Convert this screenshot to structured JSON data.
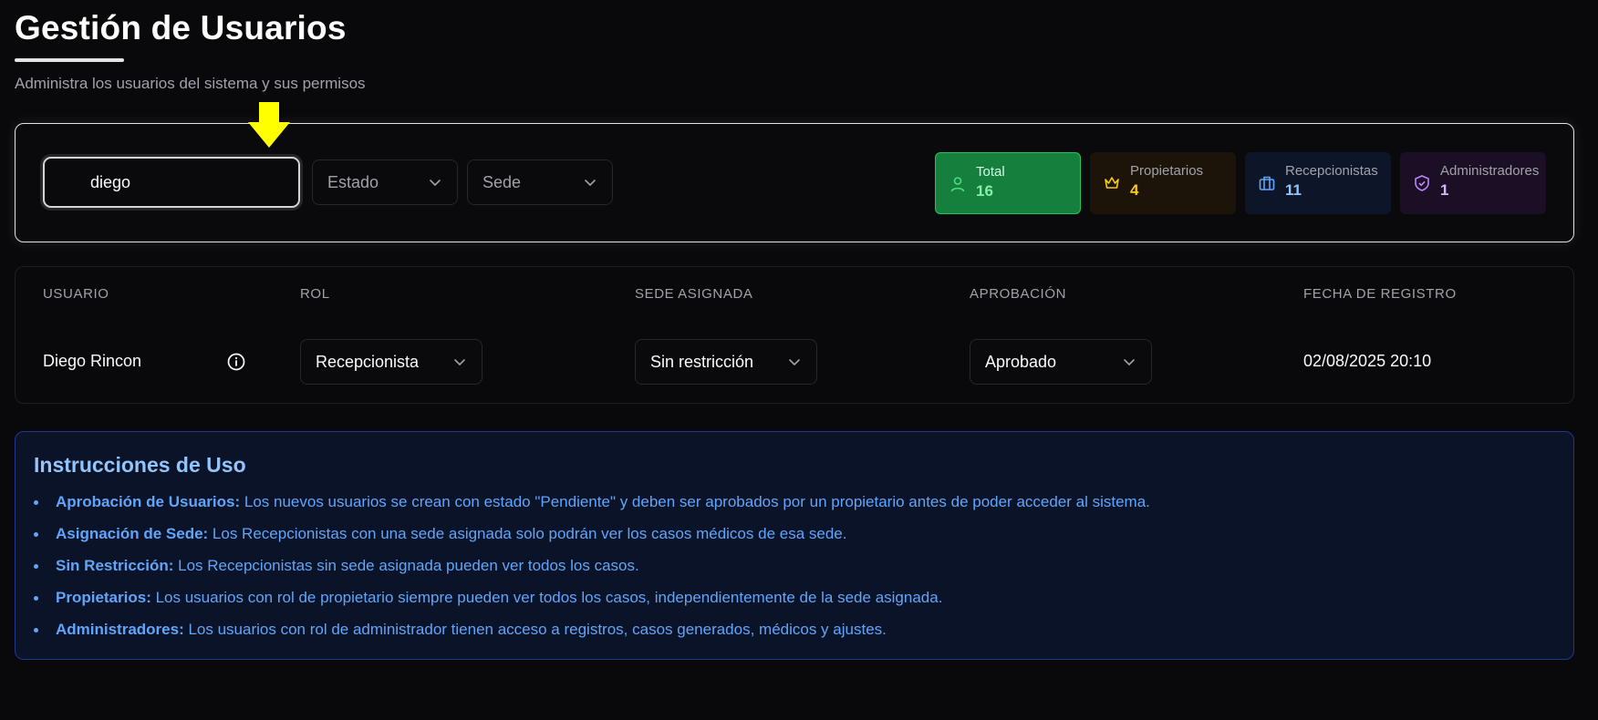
{
  "header": {
    "title": "Gestión de Usuarios",
    "subtitle": "Administra los usuarios del sistema y sus permisos"
  },
  "filters": {
    "search_value": "diego",
    "estado_label": "Estado",
    "sede_label": "Sede"
  },
  "stats": [
    {
      "label": "Total",
      "value": "16",
      "icon": "user-icon",
      "color": "#4ade80"
    },
    {
      "label": "Propietarios",
      "value": "4",
      "icon": "crown-icon",
      "color": "#facc15"
    },
    {
      "label": "Recepcionistas",
      "value": "11",
      "icon": "briefcase-icon",
      "color": "#60a5fa"
    },
    {
      "label": "Administradores",
      "value": "1",
      "icon": "shield-icon",
      "color": "#c084fc"
    }
  ],
  "table": {
    "columns": [
      "USUARIO",
      "ROL",
      "SEDE ASIGNADA",
      "APROBACIÓN",
      "FECHA DE REGISTRO"
    ],
    "rows": [
      {
        "usuario": "Diego Rincon",
        "rol": "Recepcionista",
        "sede": "Sin restricción",
        "aprobacion": "Aprobado",
        "fecha": "02/08/2025 20:10"
      }
    ]
  },
  "instructions": {
    "title": "Instrucciones de Uso",
    "items": [
      {
        "label": "Aprobación de Usuarios:",
        "text": " Los nuevos usuarios se crean con estado \"Pendiente\" y deben ser aprobados por un propietario antes de poder acceder al sistema."
      },
      {
        "label": "Asignación de Sede:",
        "text": " Los Recepcionistas con una sede asignada solo podrán ver los casos médicos de esa sede."
      },
      {
        "label": "Sin Restricción:",
        "text": " Los Recepcionistas sin sede asignada pueden ver todos los casos."
      },
      {
        "label": "Propietarios:",
        "text": " Los usuarios con rol de propietario siempre pueden ver todos los casos, independientemente de la sede asignada."
      },
      {
        "label": "Administradores:",
        "text": " Los usuarios con rol de administrador tienen acceso a registros, casos generados, médicos y ajustes."
      }
    ]
  },
  "colors": {
    "background": "#09090b",
    "accent_blue": "#60a5fa",
    "highlight_arrow": "#ffff00"
  }
}
